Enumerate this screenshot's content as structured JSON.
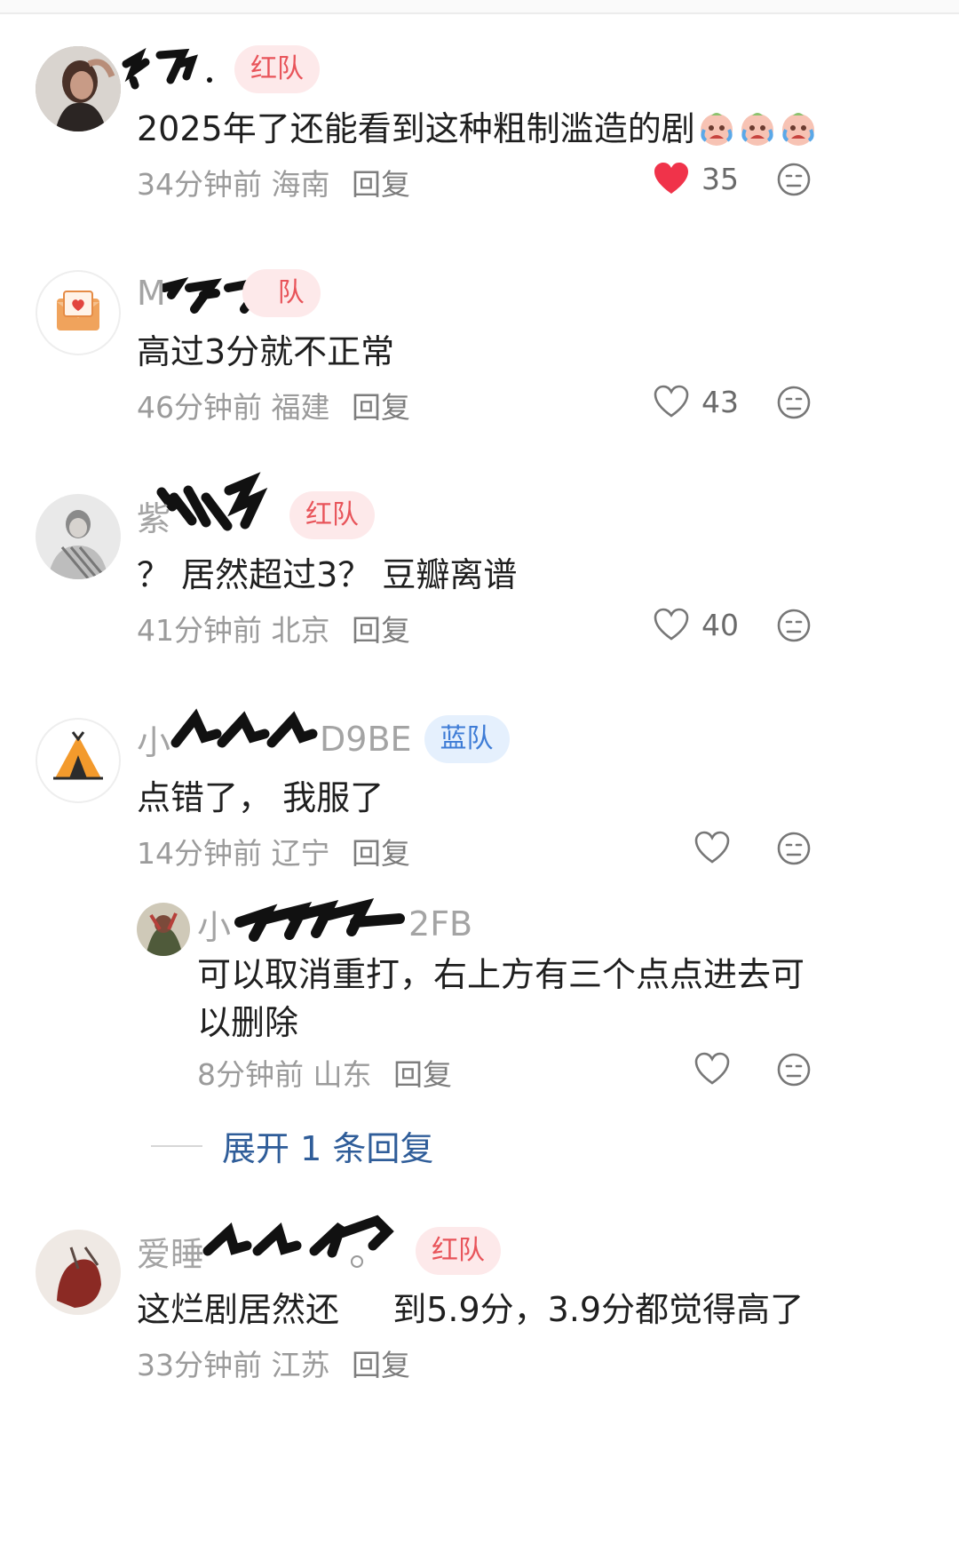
{
  "colors": {
    "red_badge_text": "#e8545a",
    "blue_badge_text": "#3e7cd6",
    "like_active": "#f0334a",
    "expand_link": "#2f5d99"
  },
  "comments": [
    {
      "name": "",
      "badge": "红队",
      "badge_type": "red",
      "text": "2025年了还能看到这种粗制滥造的剧",
      "time": "34分钟前",
      "location": "海南",
      "reply": "回复",
      "likes": "35",
      "liked": true,
      "emoji_icons": [
        "crying-face-icon",
        "crying-face-icon",
        "crying-face-icon"
      ]
    },
    {
      "name": "M",
      "badge": "红队",
      "badge_visible_suffix": "队",
      "badge_type": "red",
      "text": "高过3分就不正常",
      "time": "46分钟前",
      "location": "福建",
      "reply": "回复",
      "likes": "43",
      "liked": false
    },
    {
      "name": "紫",
      "badge": "红队",
      "badge_type": "red",
      "text": "？ 居然超过3？ 豆瓣离谱",
      "time": "41分钟前",
      "location": "北京",
      "reply": "回复",
      "likes": "40",
      "liked": false
    },
    {
      "name_prefix": "小",
      "name_suffix": "D9BE",
      "badge": "蓝队",
      "badge_type": "blue",
      "text": "点错了， 我服了",
      "time": "14分钟前",
      "location": "辽宁",
      "reply": "回复",
      "likes": "",
      "liked": false,
      "replies": [
        {
          "name_prefix": "小",
          "name_suffix": "2FB",
          "text": "可以取消重打，右上方有三个点点进去可以删除",
          "time": "8分钟前",
          "location": "山东",
          "reply": "回复"
        }
      ],
      "expand_label": "展开 1 条回复"
    },
    {
      "name_prefix": "爱睡",
      "badge": "红队",
      "badge_type": "red",
      "text": "这烂剧居然还",
      "text_after_gap": "到5.9分，3.9分都觉得高了",
      "time": "33分钟前",
      "location": "江苏",
      "reply": "回复"
    }
  ]
}
